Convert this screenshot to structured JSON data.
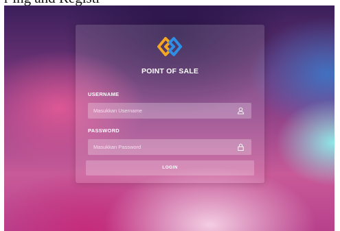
{
  "page": {
    "caption": "r ing and Registr"
  },
  "login": {
    "brand_title": "POINT OF SALE",
    "username_label": "USERNAME",
    "username_placeholder": "Masukkan Username",
    "username_value": "",
    "password_label": "PASSWORD",
    "password_placeholder": "Masukkan Password",
    "password_value": "",
    "login_button": "LOGIN"
  },
  "icons": {
    "logo": "point-of-sale-logo-icon",
    "username": "user-icon",
    "password": "lock-icon"
  },
  "colors": {
    "logo_orange": "#f5a623",
    "logo_blue": "#2f8fe6"
  }
}
